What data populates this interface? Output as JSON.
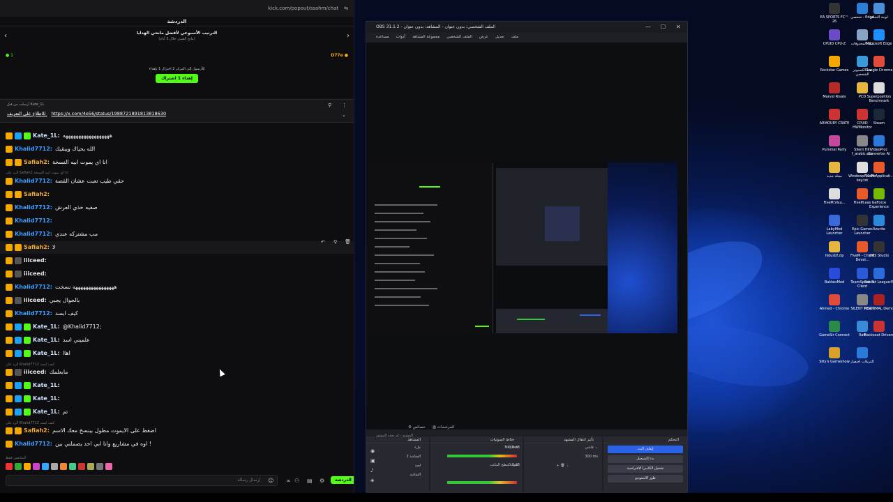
{
  "browser": {
    "url": "kick.com/popout/ssahm/chat"
  },
  "chat": {
    "title": "الدردشة",
    "rank_title": "الترتيب الأسبوعي لأفضل مانحي الهدايا",
    "rank_sub": "(مانح الصبي خلال 3 أيام)",
    "points": "D77e",
    "viewer_count": "1",
    "gift_text": "للأرسول إلى المركز 2 اخترال 1 بإهداء",
    "gift_button": "إهداء 1 اشتراك",
    "pinned_by": "أرسلت من قبل Kate_1L",
    "pinned_link": "https://x.com/4e56/status/1988721891813818630",
    "pinned_label": "للاطلاع على التعريف",
    "messages": [
      {
        "user": "Kate_1L:",
        "text": "ههههههههههههههههههه"
      },
      {
        "user": "Khalid7712:",
        "text": "الله يحياك ويبقيك"
      },
      {
        "user": "Safiah2:",
        "text": "انا اي يموت ابيه النسخة"
      },
      {
        "user": "Khalid7712:",
        "text": "حقي طيب تعبت عشان القصة"
      },
      {
        "user": "Safiah2:",
        "text": ""
      },
      {
        "user": "Khalid7712:",
        "text": "صفيه خذي العرش"
      },
      {
        "user": "Khalid7712:",
        "text": ""
      },
      {
        "user": "Khalid7712:",
        "text": "مب مشتركه عندي"
      },
      {
        "user": "Safiah2:",
        "text": "لا"
      },
      {
        "user": "iiiceed:",
        "text": ""
      },
      {
        "user": "iiiceed:",
        "text": ""
      },
      {
        "user": "Khalid7712:",
        "text": "ههههههههههههههههه نسخت"
      },
      {
        "user": "iiiceed:",
        "text": "بالجوال يجبي"
      },
      {
        "user": "Khalid7712:",
        "text": "كيف ابسد"
      },
      {
        "user": "Kate_1L:",
        "text": "@Khalid7712;"
      },
      {
        "user": "Kate_1L:",
        "text": "علميني اسد"
      },
      {
        "user": "Kate_1L:",
        "text": "اهاا"
      },
      {
        "user": "iiiceed:",
        "text": "مابعلمك"
      },
      {
        "user": "Kate_1L:",
        "text": ""
      },
      {
        "user": "Kate_1L:",
        "text": ""
      },
      {
        "user": "Kate_1L:",
        "text": "تم"
      },
      {
        "user": "Safiah2:",
        "text": "اضغط على الايموت مطول بينسخ معك الاسم"
      },
      {
        "user": "Khalid7712:",
        "text": "اوه في مشاريع وانا ابي احد يصملني بين !"
      }
    ],
    "replies": [
      "الرد على Safiah2 انا اي يموت ابيه النسخة",
      "الرد على Khalid7712 كيف ابسد",
      "الرد على Khalid7712 كيف ابسد"
    ],
    "input_placeholder": "إرسال رسالة",
    "chat_button": "الدردشة",
    "emotes_label": "المتابعين فقط"
  },
  "obs": {
    "title": "OBS 31.1.2 - الملف الشخصي: بدون عنوان - المشاهد: بدون عنوان",
    "menu": [
      "ملف",
      "تعديل",
      "عرض",
      "الملف الشخصي",
      "مجموعة المشاهد",
      "أدوات",
      "مساعدة"
    ],
    "scene_bar": "المشهد - لم يحدد المشهد",
    "properties": "خصائص",
    "filters": "المرشحات",
    "docks": {
      "scenes": "المشاهد",
      "sources": "المصادر",
      "mixer": "خلاط الصوتيات",
      "transitions": "تأثير انتقال المشهد",
      "controls": "التحكم"
    },
    "sources": [
      "ملء",
      "الشاشة 2",
      "لعبة",
      "الشاشة"
    ],
    "mixer_tracks": [
      "Mic/Aux",
      "صوت سطح المكتب"
    ],
    "mixer_db": [
      "0.0 dB",
      "0.0 dB"
    ],
    "transition": "تلاشي",
    "duration": "300 ms",
    "controls": [
      "إيقاف البث",
      "بدء التسجيل",
      "تشغيل الكاميرا الافتراضية",
      "طور الاستوديو"
    ]
  },
  "desktop_icons": [
    {
      "name": "EA SPORTS FC™ 26",
      "color": "#333"
    },
    {
      "name": "شخصي - Edge",
      "color": "#2a7fd4"
    },
    {
      "name": "لوحة التحكم",
      "color": "#4a90d9"
    },
    {
      "name": "CPUID CPU-Z",
      "color": "#6a4bc3"
    },
    {
      "name": "سلة المحذوفات",
      "color": "#8aa3c2"
    },
    {
      "name": "Microsoft Edge",
      "color": "#1e90ff"
    },
    {
      "name": "Rockstar Games",
      "color": "#f2a900"
    },
    {
      "name": "هذا الكمبيوتر الشخصي",
      "color": "#3a9ad9"
    },
    {
      "name": "Google Chrome",
      "color": "#e04b3a"
    },
    {
      "name": "Marvel Rivals",
      "color": "#b52a2a"
    },
    {
      "name": "PCD",
      "color": "#e6b740"
    },
    {
      "name": "Superposition Benchmark",
      "color": "#ddd"
    },
    {
      "name": "ARMOURY CRATE",
      "color": "#c33"
    },
    {
      "name": "CPUID HWMonitor",
      "color": "#c33"
    },
    {
      "name": "Steam",
      "color": "#1b2838"
    },
    {
      "name": "Pummel Party",
      "color": "#c4489b"
    },
    {
      "name": "Silent Hill f_arabic.exe",
      "color": "#888"
    },
    {
      "name": "VideoProc Converter AI",
      "color": "#2a7ad9"
    },
    {
      "name": "مجلد جديد",
      "color": "#e6b740"
    },
    {
      "name": "Windows 11 Pro key.txt",
      "color": "#ddd"
    },
    {
      "name": "FiveM Applicati...",
      "color": "#e85a2a"
    },
    {
      "name": "FiveM.Visu...",
      "color": "#ddd"
    },
    {
      "name": "FiveM.exe",
      "color": "#e85a2a"
    },
    {
      "name": "GeForce Experience",
      "color": "#76b900"
    },
    {
      "name": "LabyMod Launcher",
      "color": "#3a6ad9"
    },
    {
      "name": "Epic Games Launcher",
      "color": "#333"
    },
    {
      "name": "Azurite",
      "color": "#2a8ad9"
    },
    {
      "name": "hidusbf.zip",
      "color": "#e6b740"
    },
    {
      "name": "FiveM - Chure Devel...",
      "color": "#e85a2a"
    },
    {
      "name": "OBS Studio",
      "color": "#333"
    },
    {
      "name": "BakkesMod",
      "color": "#2a4ad9"
    },
    {
      "name": "TeamSpeak 3 Client",
      "color": "#2a5ad9"
    },
    {
      "name": "Rocket League®",
      "color": "#2a6ad9"
    },
    {
      "name": "Ahmed - Chrome",
      "color": "#e04b3a"
    },
    {
      "name": "SILENT HILL f",
      "color": "#888"
    },
    {
      "name": "REANIMAL Demo",
      "color": "#a22"
    },
    {
      "name": "GameSir Connect",
      "color": "#2a8a4a"
    },
    {
      "name": "Raft",
      "color": "#3a8ad9"
    },
    {
      "name": "Backseat Drivers",
      "color": "#c33"
    },
    {
      "name": "Silly's Gameshow",
      "color": "#d9a02a"
    },
    {
      "name": "التنزيلات اختصار",
      "color": "#2a7ad9"
    }
  ]
}
